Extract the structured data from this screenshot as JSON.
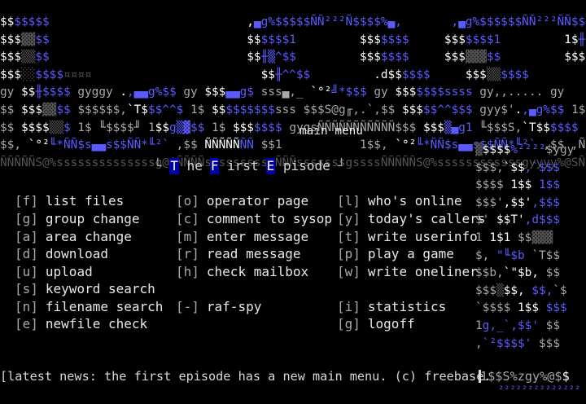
{
  "screen": {
    "board_name_letters": [
      "T",
      "F",
      "E"
    ],
    "board_name_words": [
      "he",
      "irst",
      "pisode"
    ],
    "board_name": "The First Episode",
    "menu_title": "main menu",
    "title_open_bracket": "└",
    "title_close_bracket": "┘"
  },
  "menu": {
    "col1": [
      {
        "key": "[f]",
        "label": "list files"
      },
      {
        "key": "[g]",
        "label": "group change"
      },
      {
        "key": "[a]",
        "label": "area change"
      },
      {
        "key": "[d]",
        "label": "download"
      },
      {
        "key": "[u]",
        "label": "upload"
      },
      {
        "key": "[s]",
        "label": "keyword search"
      },
      {
        "key": "[n]",
        "label": "filename search"
      },
      {
        "key": "[e]",
        "label": "newfile check"
      }
    ],
    "col2": [
      {
        "key": "[o]",
        "label": "operator page"
      },
      {
        "key": "[c]",
        "label": "comment to sysop"
      },
      {
        "key": "[m]",
        "label": "enter message"
      },
      {
        "key": "[r]",
        "label": "read message"
      },
      {
        "key": "[h]",
        "label": "check mailbox"
      },
      {
        "key": "[-]",
        "label": "raf-spy"
      }
    ],
    "col3": [
      {
        "key": "[l]",
        "label": "who's online"
      },
      {
        "key": "[y]",
        "label": "today's callers"
      },
      {
        "key": "[t]",
        "label": "write userinfo"
      },
      {
        "key": "[p]",
        "label": "play a game"
      },
      {
        "key": "[w]",
        "label": "write oneliner"
      },
      {
        "key": "[i]",
        "label": "statistics"
      },
      {
        "key": "[g]",
        "label": "logoff"
      }
    ]
  },
  "news": {
    "text": "[latest news: the first episode has a new main menu. (c) freebase."
  },
  "colors": {
    "background": "#000000",
    "text": "#e8e8e8",
    "gray": "#a8a8a8",
    "dark_gray": "#545454",
    "bright_blue": "#5a5aff",
    "dark_blue": "#0000a8",
    "white": "#ffffff"
  }
}
